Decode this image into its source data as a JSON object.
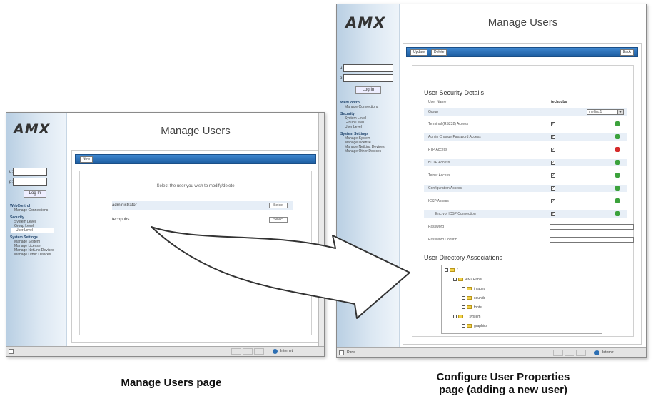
{
  "logo": "AMX",
  "login": {
    "user_label": "u:",
    "pass_label": "p:",
    "button": "Log In"
  },
  "nav": [
    {
      "section": "WebControl",
      "items": [
        "Manage Connections"
      ]
    },
    {
      "section": "Security",
      "items": [
        "System Level",
        "Group Level",
        "User Level"
      ]
    },
    {
      "section": "System Settings",
      "items": [
        "Manage System",
        "Manage License",
        "Manage NetLinx Devices",
        "Manage Other Devices"
      ]
    }
  ],
  "manage_users": {
    "title": "Manage Users",
    "new_button": "New",
    "prompt": "Select the user you wish to modify/delete",
    "users": [
      {
        "name": "administrator",
        "button": "Select"
      },
      {
        "name": "techpubs",
        "button": "Select"
      }
    ],
    "status_zone": "Internet"
  },
  "configure_user": {
    "title": "Manage Users",
    "buttons": {
      "update": "Update",
      "delete": "Delete",
      "back": "Back"
    },
    "details_heading": "User Security Details",
    "username_label": "User Name",
    "username_value": "techpubs",
    "group_label": "Group",
    "group_value": "netlinx1",
    "access": [
      {
        "label": "Terminal (RS232) Access",
        "checked": true,
        "status": "ok"
      },
      {
        "label": "Admin Change Password Access",
        "checked": true,
        "status": "ok"
      },
      {
        "label": "FTP Access",
        "checked": true,
        "status": "error"
      },
      {
        "label": "HTTP Access",
        "checked": true,
        "status": "ok"
      },
      {
        "label": "Telnet Access",
        "checked": true,
        "status": "ok"
      },
      {
        "label": "Configuration Access",
        "checked": true,
        "status": "ok"
      },
      {
        "label": "ICSP Access",
        "checked": true,
        "status": "ok"
      },
      {
        "label": "Encrypt ICSP Connection",
        "checked": true,
        "status": "ok"
      }
    ],
    "password_label": "Password",
    "password_confirm_label": "Password Confirm",
    "directory_heading": "User Directory Associations",
    "tree": [
      {
        "label": "/",
        "depth": 0
      },
      {
        "label": "AMXPanel",
        "depth": 1
      },
      {
        "label": "images",
        "depth": 2
      },
      {
        "label": "sounds",
        "depth": 2
      },
      {
        "label": "fonts",
        "depth": 2
      },
      {
        "label": "__system",
        "depth": 1
      },
      {
        "label": "graphics",
        "depth": 2
      }
    ],
    "status_left": "Done",
    "status_zone": "Internet"
  },
  "captions": {
    "left": "Manage Users page",
    "right_line1": "Configure User Properties",
    "right_line2": "page (adding a new user)"
  },
  "colors": {
    "toolbar": "#1d5da0",
    "ok": "#3ca23c",
    "error": "#d52b2b",
    "sidebar": "#b9cfe3"
  }
}
